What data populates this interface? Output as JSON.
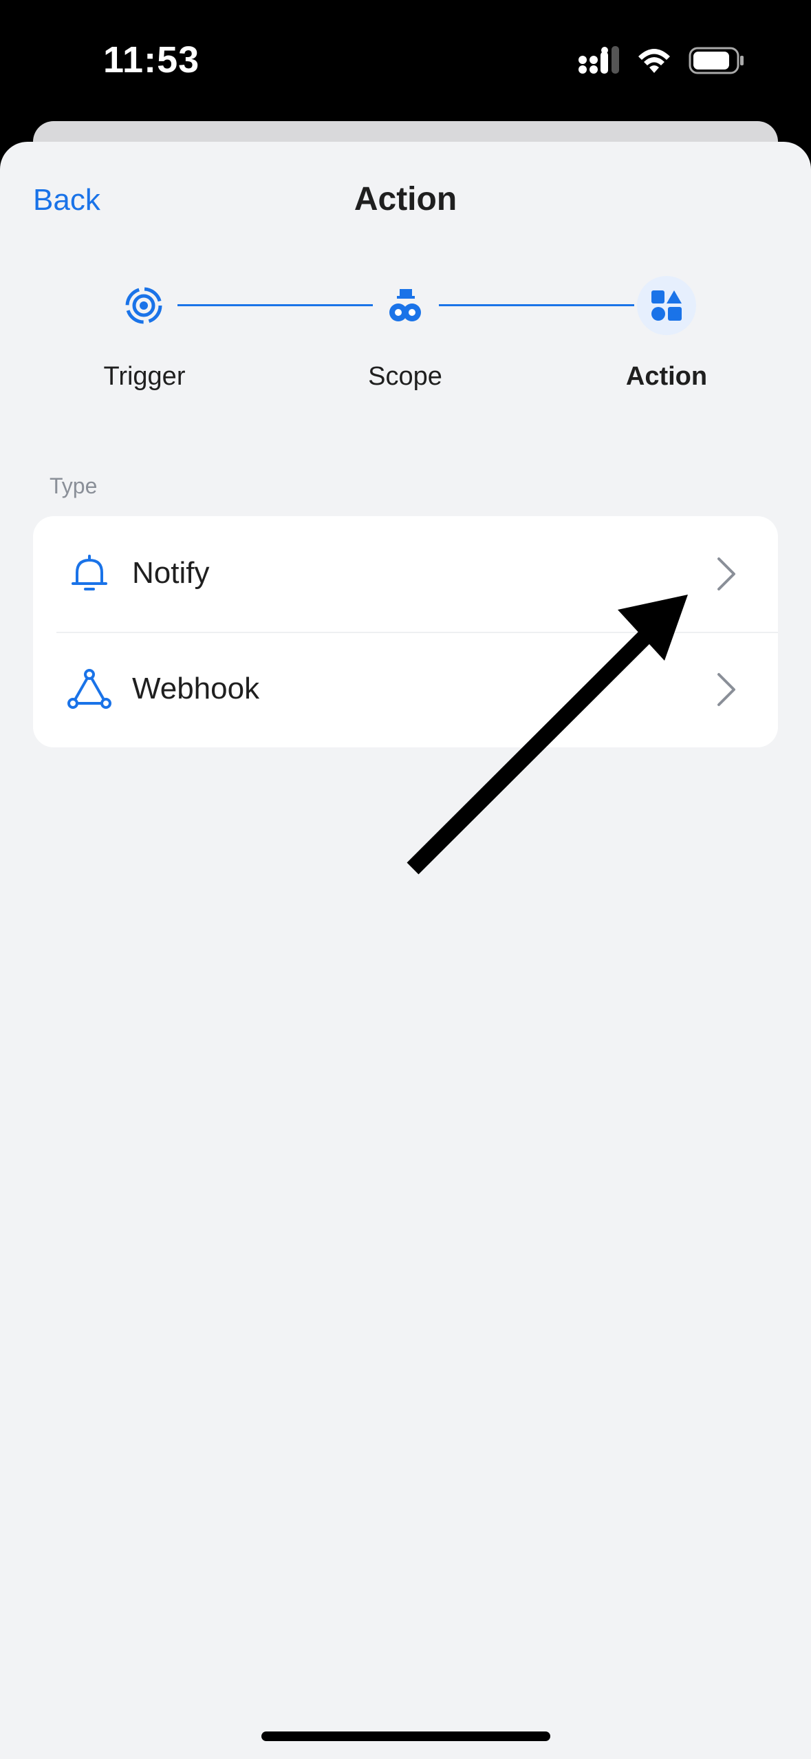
{
  "status": {
    "time": "11:53"
  },
  "nav": {
    "back_label": "Back",
    "title": "Action"
  },
  "stepper": {
    "steps": [
      {
        "label": "Trigger",
        "icon": "target-icon",
        "state": "completed"
      },
      {
        "label": "Scope",
        "icon": "scope-icon",
        "state": "completed"
      },
      {
        "label": "Action",
        "icon": "shapes-icon",
        "state": "active"
      }
    ]
  },
  "section": {
    "label": "Type"
  },
  "types": [
    {
      "label": "Notify",
      "icon": "bell-icon"
    },
    {
      "label": "Webhook",
      "icon": "webhook-icon"
    }
  ],
  "colors": {
    "accent": "#1a73e8",
    "background": "#f2f3f5",
    "card": "#ffffff"
  }
}
